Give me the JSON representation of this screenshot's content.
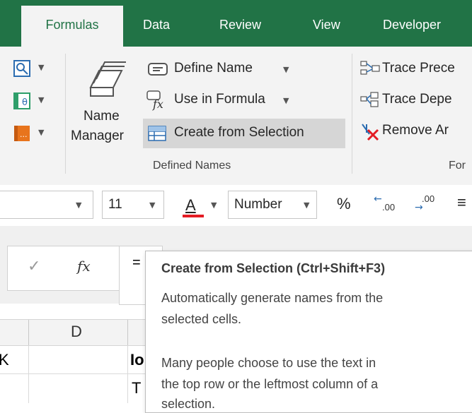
{
  "tabs": {
    "formulas": "Formulas",
    "data": "Data",
    "review": "Review",
    "view": "View",
    "developer": "Developer"
  },
  "ribbon": {
    "define_name": "Define Name",
    "use_in_formula": "Use in Formula",
    "create_from_selection": "Create from Selection",
    "name_manager_line1": "Name",
    "name_manager_line2": "Manager",
    "defined_names_group": "Defined Names",
    "trace_precedents": "Trace Prece",
    "trace_dependents": "Trace Depe",
    "remove_arrows": "Remove Ar",
    "formula_auditing_group": "For",
    "fx_glyph": "fx"
  },
  "toolbar": {
    "font_size": "11",
    "font_color_letter": "A",
    "number_format": "Number",
    "percent": "%",
    "increase_decimal": ".00",
    "decrease_decimal": ".00"
  },
  "sheet": {
    "column_d": "D",
    "cell_k": "K",
    "cell_lo": "Io",
    "cell_t": "T",
    "formula_equals": "="
  },
  "tooltip": {
    "title": "Create from Selection (Ctrl+Shift+F3)",
    "line1": "Automatically generate names from the",
    "line2": "selected cells.",
    "line3": "Many people choose to use the text in",
    "line4": "the top row or the leftmost column of a",
    "line5": "selection."
  },
  "colors": {
    "excel_green": "#217346",
    "ribbon_bg": "#f3f3f3",
    "highlight": "#d6d6d6",
    "font_color_bar": "#e31b23"
  }
}
